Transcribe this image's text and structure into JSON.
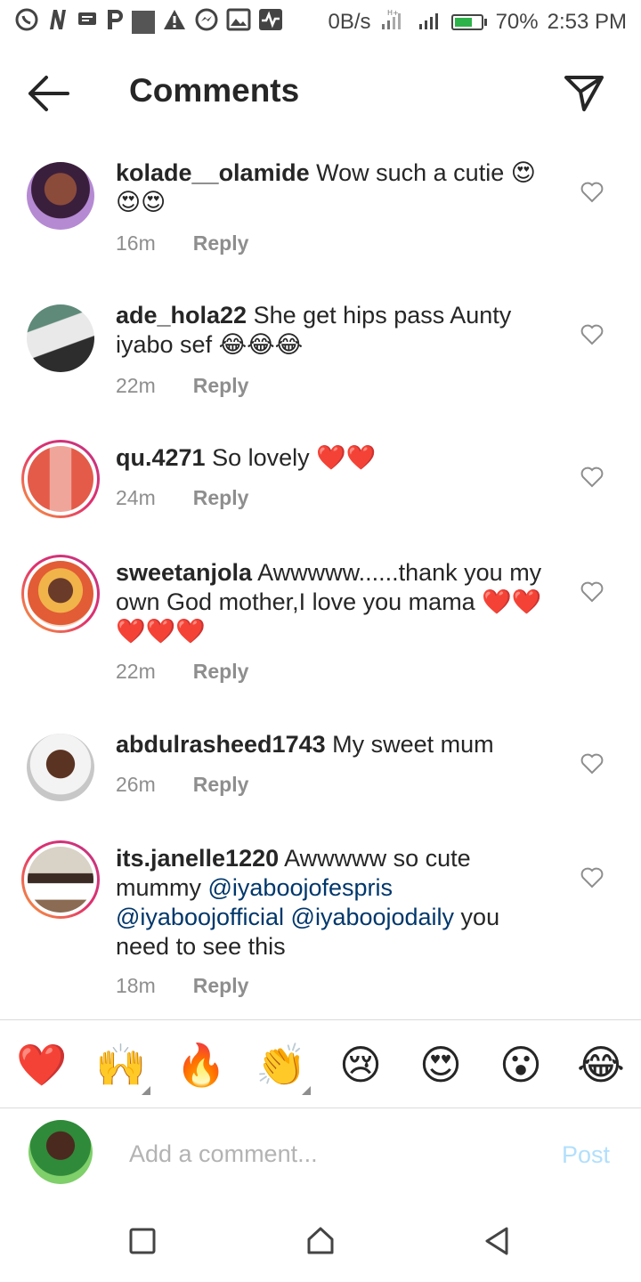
{
  "status_bar": {
    "left_icons": [
      "whatsapp-icon",
      "n-icon",
      "message-icon",
      "p-icon",
      "square-icon",
      "alert-icon",
      "messenger-icon",
      "gallery-icon",
      "activity-icon"
    ],
    "net_speed": "0B/s",
    "battery": "70%",
    "battery_level": 0.7,
    "time": "2:53 PM"
  },
  "header": {
    "title": "Comments"
  },
  "comments": [
    {
      "username": "kolade__olamide",
      "text": " Wow such a cutie ",
      "emojis": "😍😍😍",
      "time": "16m",
      "reply_label": "Reply"
    },
    {
      "username": "ade_hola22",
      "text": " She get hips pass Aunty iyabo sef ",
      "emojis": "😂😂😂",
      "time": "22m",
      "reply_label": "Reply"
    },
    {
      "username": "qu.4271",
      "text": " So lovely ",
      "emojis": "❤️❤️",
      "time": "24m",
      "reply_label": "Reply"
    },
    {
      "username": "sweetanjola",
      "text": " Awwwww......thank you my own God mother,I love you mama ",
      "emojis": "❤️❤️❤️❤️❤️",
      "time": "22m",
      "reply_label": "Reply"
    },
    {
      "username": "abdulrasheed1743",
      "text": " My sweet mum",
      "emojis": "",
      "time": "26m",
      "reply_label": "Reply"
    },
    {
      "username": "its.janelle1220",
      "text_parts": [
        " Awwwww so cute mummy ",
        "@iyaboojofespris",
        " ",
        "@iyaboojofficial",
        " ",
        "@iyaboojodaily",
        " you need to see this"
      ],
      "time": "18m",
      "reply_label": "Reply"
    }
  ],
  "reactions": [
    "❤️",
    "🙌",
    "🔥",
    "👏",
    "😢",
    "😍",
    "😮",
    "😂"
  ],
  "composer": {
    "placeholder": "Add a comment...",
    "post_label": "Post"
  },
  "colors": {
    "mention": "#00376b",
    "post_disabled": "#b2dffc",
    "meta_gray": "#8e8e8e"
  }
}
